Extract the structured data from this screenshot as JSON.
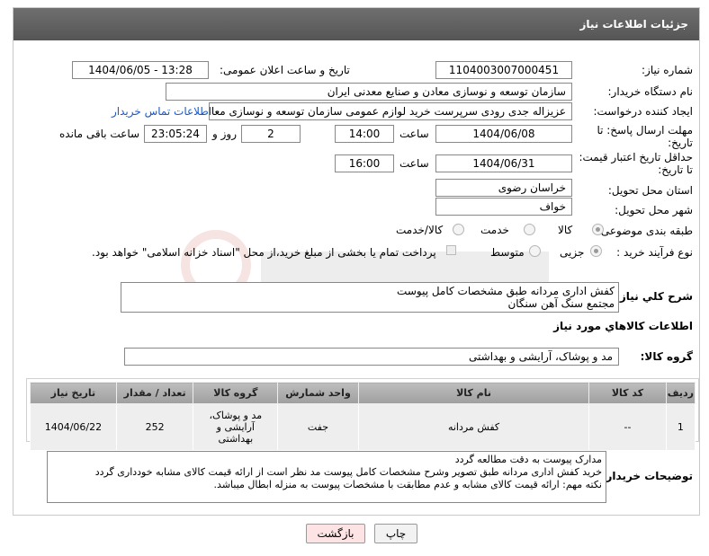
{
  "header": {
    "title": "جزئیات اطلاعات نیاز"
  },
  "labels": {
    "need_number": "شماره نیاز:",
    "announce_date": "تاریخ و ساعت اعلان عمومی:",
    "buyer_org": "نام دستگاه خریدار:",
    "requester": "ایجاد کننده درخواست:",
    "contact_link": "اطلاعات تماس خریدار",
    "reply_deadline_1": "مهلت ارسال پاسخ: تا",
    "reply_deadline_2": "تاریخ:",
    "time": "ساعت",
    "day_and": "روز و",
    "remaining": "ساعت باقی مانده",
    "price_validity_1": "حداقل تاریخ اعتبار قیمت:",
    "price_validity_2": "تا تاریخ:",
    "province": "استان محل تحویل:",
    "city": "شهر محل تحویل:",
    "category": "طبقه بندی موضوعی:",
    "process_type": "نوع فرآیند خرید :",
    "general_desc": "شرح كلي نياز:",
    "goods_info": "اطلاعات كالاهاي مورد نياز",
    "goods_group": "گروه کالا:",
    "buyer_notes": "توضیحات خریدار:"
  },
  "values": {
    "need_number": "1104003007000451",
    "announce_date": "1404/06/05 - 13:28",
    "buyer_org": "سازمان توسعه و نوسازی معادن و صنایع معدنی ایران",
    "requester": "عزیزاله جدی رودی سرپرست خرید لوازم عمومی  سازمان توسعه و نوسازی معادن",
    "reply_date": "1404/06/08",
    "reply_time": "14:00",
    "reply_days": "2",
    "reply_remaining": "23:05:24",
    "validity_date": "1404/06/31",
    "validity_time": "16:00",
    "province": "خراسان رضوی",
    "city": "خواف",
    "general_desc_line1": "کفش اداری مردانه طبق مشخصات کامل پیوست",
    "general_desc_line2": "مجتمع سنگ آهن سنگان",
    "goods_group": "مد و پوشاک، آرایشی و بهداشتی",
    "notes_line1": "مدارک پیوست به دقت مطالعه گردد",
    "notes_line2": "خرید کفش اداری مردانه طبق تصویر وشرح مشخصات کامل پیوست مد نظر است از ارائه قیمت کالای مشابه خودداری گردد",
    "notes_line3": "نکته مهم: ارائه قیمت کالای مشابه و عدم مطابقت با مشخصات پیوست به منزله ابطال میباشد."
  },
  "category_options": [
    {
      "label": "کالا",
      "selected": true
    },
    {
      "label": "خدمت",
      "selected": false
    },
    {
      "label": "کالا/خدمت",
      "selected": false
    }
  ],
  "process_options": [
    {
      "label": "جزیی",
      "selected": true
    },
    {
      "label": "متوسط",
      "selected": false
    }
  ],
  "payment_note": "پرداخت تمام یا بخشی از مبلغ خرید،از محل \"اسناد خزانه اسلامی\" خواهد بود.",
  "table": {
    "headers": [
      "ردیف",
      "کد کالا",
      "نام کالا",
      "واحد شمارش",
      "گروه کالا",
      "تعداد / مقدار",
      "تاریخ نیاز"
    ],
    "rows": [
      [
        "1",
        "--",
        "کفش مردانه",
        "جفت",
        "مد و پوشاک، آرایشی و بهداشتی",
        "252",
        "1404/06/22"
      ]
    ]
  },
  "buttons": {
    "print": "چاپ",
    "back": "بازگشت"
  },
  "colors": {
    "header_bg": "#5e5e5e",
    "link": "#1a58c7",
    "back_button_bg": "#fde3e3"
  }
}
